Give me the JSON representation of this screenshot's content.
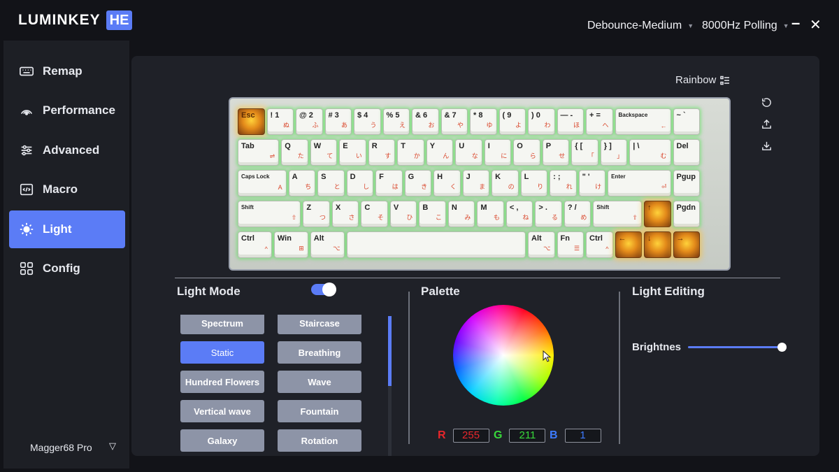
{
  "app": {
    "logo": "LUMINKEY",
    "badge": "HE"
  },
  "titlebar": {
    "debounce": "Debounce-Medium",
    "polling": "8000Hz Polling",
    "minimize": "–",
    "close": "✕"
  },
  "sidebar": {
    "items": [
      {
        "label": "Remap",
        "icon": "keyboard-icon"
      },
      {
        "label": "Performance",
        "icon": "signal-icon"
      },
      {
        "label": "Advanced",
        "icon": "sliders-icon"
      },
      {
        "label": "Macro",
        "icon": "code-icon"
      },
      {
        "label": "Light",
        "icon": "sun-icon",
        "active": true
      },
      {
        "label": "Config",
        "icon": "grid-icon"
      }
    ],
    "device": "Magger68 Pro",
    "device_caret": "▽"
  },
  "main": {
    "effect_label": "Rainbow",
    "keyboard": {
      "rows": [
        [
          [
            "Esc",
            ""
          ],
          [
            "! 1",
            "ぬ"
          ],
          [
            "@ 2",
            "ふ"
          ],
          [
            "# 3",
            "あ"
          ],
          [
            "$ 4",
            "う"
          ],
          [
            "% 5",
            "え"
          ],
          [
            "& 6",
            "お"
          ],
          [
            "& 7",
            "や"
          ],
          [
            "* 8",
            "ゆ"
          ],
          [
            "( 9",
            "よ"
          ],
          [
            ") 0",
            "わ"
          ],
          [
            "— -",
            "ほ"
          ],
          [
            "+ =",
            "へ"
          ],
          [
            "Backspace",
            "←"
          ],
          [
            "~ `",
            ""
          ]
        ],
        [
          [
            "Tab",
            "⇌"
          ],
          [
            "Q",
            "た"
          ],
          [
            "W",
            "て"
          ],
          [
            "E",
            "い"
          ],
          [
            "R",
            "す"
          ],
          [
            "T",
            "か"
          ],
          [
            "Y",
            "ん"
          ],
          [
            "U",
            "な"
          ],
          [
            "I",
            "に"
          ],
          [
            "O",
            "ら"
          ],
          [
            "P",
            "せ"
          ],
          [
            "{ [",
            "「"
          ],
          [
            "} ]",
            "」"
          ],
          [
            "| \\",
            "む"
          ],
          [
            "Del",
            ""
          ]
        ],
        [
          [
            "Caps Lock",
            "A"
          ],
          [
            "A",
            "ち"
          ],
          [
            "S",
            "と"
          ],
          [
            "D",
            "し"
          ],
          [
            "F",
            "は"
          ],
          [
            "G",
            "き"
          ],
          [
            "H",
            "く"
          ],
          [
            "J",
            "ま"
          ],
          [
            "K",
            "の"
          ],
          [
            "L",
            "り"
          ],
          [
            ": ;",
            "れ"
          ],
          [
            "\" '",
            "け"
          ],
          [
            "Enter",
            "⏎"
          ],
          [
            "Pgup",
            ""
          ]
        ],
        [
          [
            "Shift",
            "⇧"
          ],
          [
            "Z",
            "つ"
          ],
          [
            "X",
            "さ"
          ],
          [
            "C",
            "そ"
          ],
          [
            "V",
            "ひ"
          ],
          [
            "B",
            "こ"
          ],
          [
            "N",
            "み"
          ],
          [
            "M",
            "も"
          ],
          [
            "< ,",
            "ね"
          ],
          [
            "> .",
            "る"
          ],
          [
            "? /",
            "め"
          ],
          [
            "Shift",
            "⇧"
          ],
          [
            "↑",
            ""
          ],
          [
            "Pgdn",
            ""
          ]
        ],
        [
          [
            "Ctrl",
            "^"
          ],
          [
            "Win",
            "⊞"
          ],
          [
            "Alt",
            "⌥"
          ],
          [
            "",
            ""
          ],
          [
            "Alt",
            "⌥"
          ],
          [
            "Fn",
            "☰"
          ],
          [
            "Ctrl",
            "^"
          ],
          [
            "←",
            ""
          ],
          [
            "↓",
            ""
          ],
          [
            "→",
            ""
          ]
        ]
      ]
    },
    "light_mode": {
      "title": "Light Mode",
      "enabled": true,
      "modes": [
        "Spectrum",
        "Staircase",
        "Static",
        "Breathing",
        "Hundred Flowers",
        "Wave",
        "Vertical wave",
        "Fountain",
        "Galaxy",
        "Rotation"
      ],
      "active_mode": "Static"
    },
    "palette": {
      "title": "Palette",
      "r_label": "R",
      "g_label": "G",
      "b_label": "B",
      "r": "255",
      "g": "211",
      "b": "1"
    },
    "light_editing": {
      "title": "Light Editing",
      "brightness_label": "Brightnes",
      "brightness": 1.0
    }
  },
  "colors": {
    "accent": "#5b7cf6",
    "panel": "#1f2128",
    "background": "#121318",
    "mode_button": "#8d94a7"
  }
}
